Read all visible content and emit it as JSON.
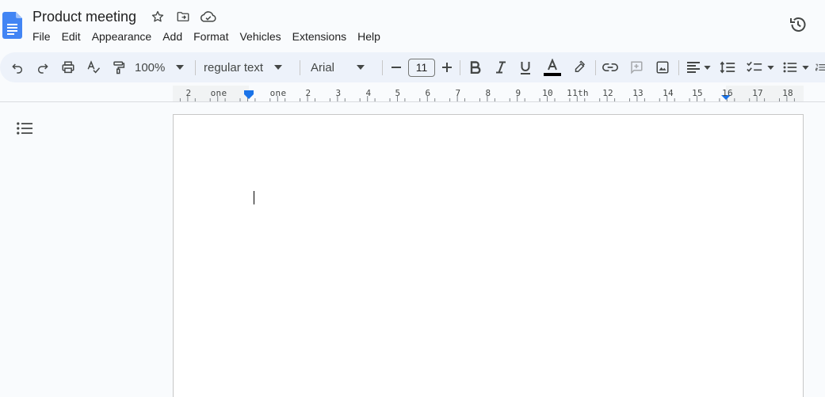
{
  "document": {
    "title": "Product meeting",
    "icons": {
      "logo": "docs-logo-icon",
      "star": "star-icon",
      "move": "move-to-folder-icon",
      "cloud": "cloud-saved-icon",
      "history": "version-history-icon"
    }
  },
  "menu": [
    "File",
    "Edit",
    "Appearance",
    "Add",
    "Format",
    "Vehicles",
    "Extensions",
    "Help"
  ],
  "toolbar": {
    "zoom": "100%",
    "style": "regular text",
    "font": "Arial",
    "font_size": "11",
    "text_color": "#000000",
    "icons": [
      "undo-icon",
      "redo-icon",
      "print-icon",
      "spellcheck-icon",
      "paint-format-icon",
      "decrease-font-icon",
      "increase-font-icon",
      "bold-icon",
      "italic-icon",
      "underline-icon",
      "text-color-icon",
      "highlight-icon",
      "link-icon",
      "add-comment-icon",
      "insert-image-icon",
      "align-icon",
      "line-spacing-icon",
      "checklist-icon",
      "bulleted-list-icon",
      "numbered-list-icon"
    ]
  },
  "ruler": {
    "labels": [
      "2",
      "one",
      "one",
      "2",
      "3",
      "4",
      "5",
      "6",
      "7",
      "8",
      "9",
      "10",
      "11th",
      "12",
      "13",
      "14",
      "15",
      "16",
      "17",
      "18"
    ]
  },
  "colors": {
    "accent": "#1a73e8",
    "toolbar_bg": "#edf2fa",
    "app_bg": "#f9fbfd",
    "page_bg": "#ffffff"
  }
}
